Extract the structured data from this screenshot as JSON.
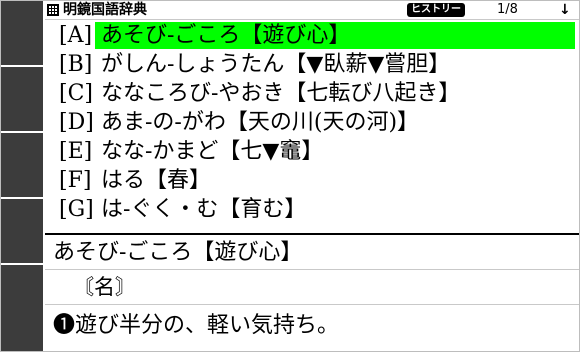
{
  "header": {
    "title": "明鏡国語辞典",
    "history_label": "ヒストリー",
    "counter": "1/8",
    "down_arrow": "↓"
  },
  "list": {
    "items": [
      {
        "key": "[A]",
        "text": "あそび-ごころ【遊び心】"
      },
      {
        "key": "[B]",
        "text": "がしん-しょうたん【▼臥薪▼嘗胆】"
      },
      {
        "key": "[C]",
        "text": "ななころび-やおき【七転び八起き】"
      },
      {
        "key": "[D]",
        "text": "あま-の-がわ【天の川(天の河)】"
      },
      {
        "key": "[E]",
        "text": "なな-かまど【七▼竈】"
      },
      {
        "key": "[F]",
        "text": "はる【春】"
      },
      {
        "key": "[G]",
        "text": "は-ぐく・む【育む】"
      }
    ],
    "selected_index": 0
  },
  "detail": {
    "headword": "あそび-ごころ【遊び心】",
    "part_of_speech": "〘名〙",
    "definition": "❶遊び半分の、軽い気持ち。"
  },
  "colors": {
    "highlight": "#00ff00",
    "side_bar": "#3c3c3c"
  }
}
